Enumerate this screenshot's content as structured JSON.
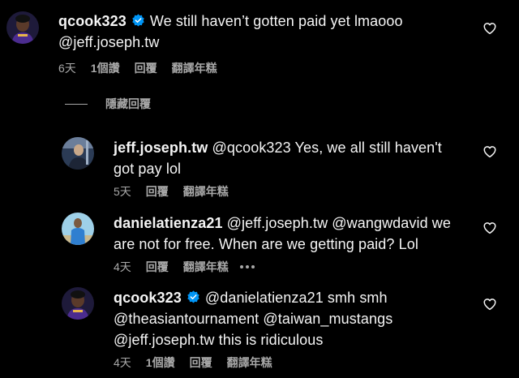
{
  "comments": [
    {
      "username": "qcook323",
      "verified": true,
      "text_line1": "We still haven’t gotten paid yet lmaooo",
      "text_line2": "@jeff.joseph.tw",
      "time": "6天",
      "likes": "1個讚",
      "reply": "回覆",
      "translate": "翻譯年糕"
    },
    {
      "username": "jeff.joseph.tw",
      "verified": false,
      "mention": "@qcook323",
      "text_line1": "Yes, we all still haven't",
      "text_line2": "got pay lol",
      "time": "5天",
      "reply": "回覆",
      "translate": "翻譯年糕"
    },
    {
      "username": "danielatienza21",
      "verified": false,
      "text_line1": "@jeff.joseph.tw @wangwdavid we",
      "text_line2": "are not for free. When are we getting paid? Lol",
      "time": "4天",
      "reply": "回覆",
      "translate": "翻譯年糕"
    },
    {
      "username": "qcook323",
      "verified": true,
      "text_line1": "@danielatienza21 smh smh",
      "text_line2": "@theasiantournament @taiwan_mustangs",
      "text_line3": "@jeff.joseph.tw this is ridiculous",
      "time": "4天",
      "likes": "1個讚",
      "reply": "回覆",
      "translate": "翻譯年糕"
    }
  ],
  "hide_replies_label": "隱藏回覆",
  "colors": {
    "background": "#000000",
    "text": "#f5f5f5",
    "secondary": "#a8a8a8",
    "verified_badge": "#0095f6"
  },
  "icons": {
    "heart": "heart-outline-icon",
    "verified": "verified-badge-icon",
    "more": "more-horizontal-icon"
  }
}
